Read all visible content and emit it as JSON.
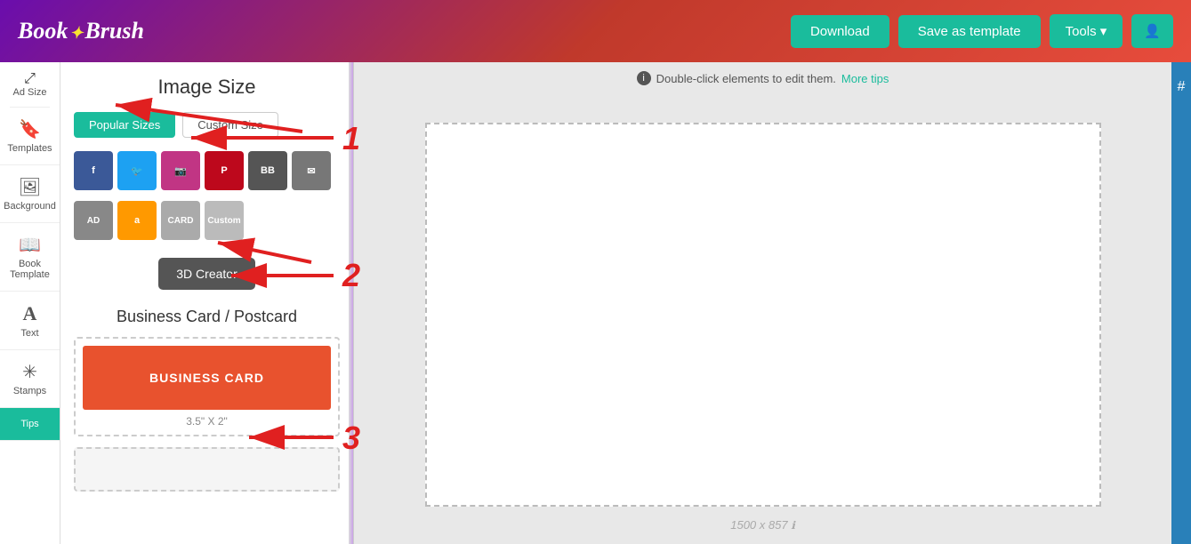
{
  "header": {
    "logo": "Book Brush",
    "download_label": "Download",
    "save_template_label": "Save as template",
    "tools_label": "Tools ▾",
    "user_icon": "👤"
  },
  "sidebar": {
    "ad_size_label": "Ad Size",
    "templates_label": "Templates",
    "background_label": "Background",
    "book_template_label": "Book Template",
    "text_label": "Text",
    "stamps_label": "Stamps",
    "tips_label": "Tips"
  },
  "panel": {
    "title": "Image Size",
    "tab_popular": "Popular Sizes",
    "tab_custom": "Custom Size",
    "btn_3d": "3D Creator",
    "section_title": "Business Card / Postcard",
    "card_label": "BUSINESS CARD",
    "card_size": "3.5\" X 2\""
  },
  "info_bar": {
    "message": "Double-click elements to edit them.",
    "link": "More tips"
  },
  "canvas": {
    "size_label": "1500 x 857"
  },
  "annotations": {
    "n1": "1",
    "n2": "2",
    "n3": "3"
  }
}
